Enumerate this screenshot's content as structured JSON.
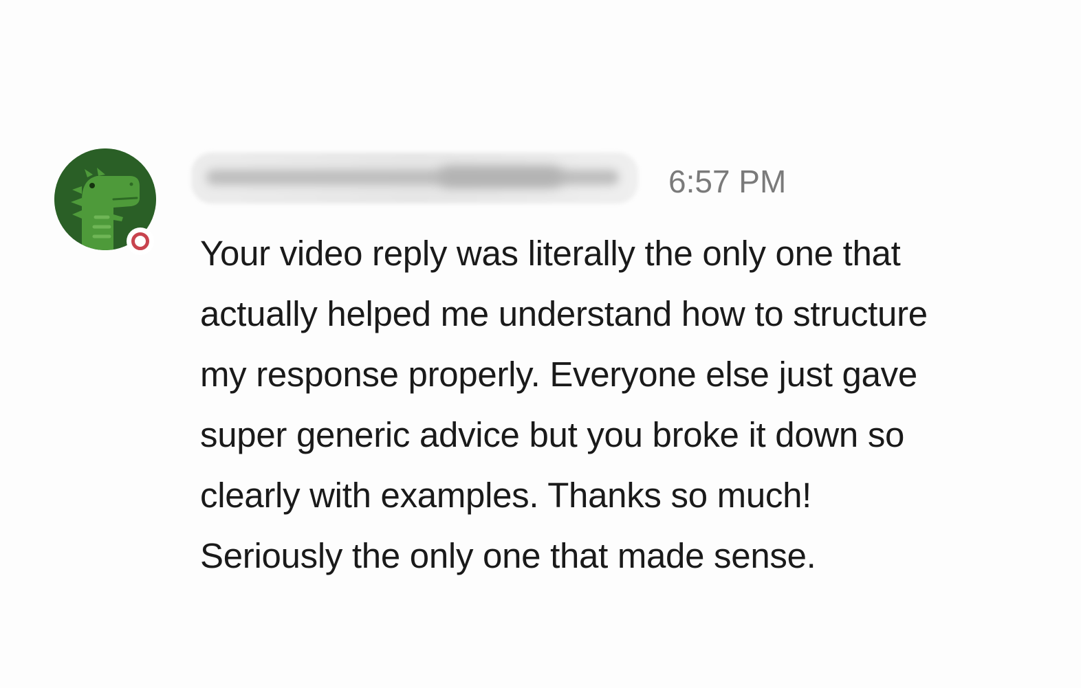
{
  "message": {
    "sender_name": "",
    "timestamp": "6:57 PM",
    "body_lines": [
      "Your video reply was literally the only one that",
      "actually helped me understand how to structure",
      "my response properly. Everyone else just gave",
      "super generic advice but you broke it down so",
      "clearly with examples. Thanks so much!",
      "Seriously the only one that made sense."
    ]
  },
  "avatar": {
    "icon": "dinosaur-icon",
    "background_color": "#2a5f26",
    "figure_color": "#4e9a3a"
  },
  "presence": {
    "icon": "presence-status-icon",
    "color": "#c8434e"
  }
}
